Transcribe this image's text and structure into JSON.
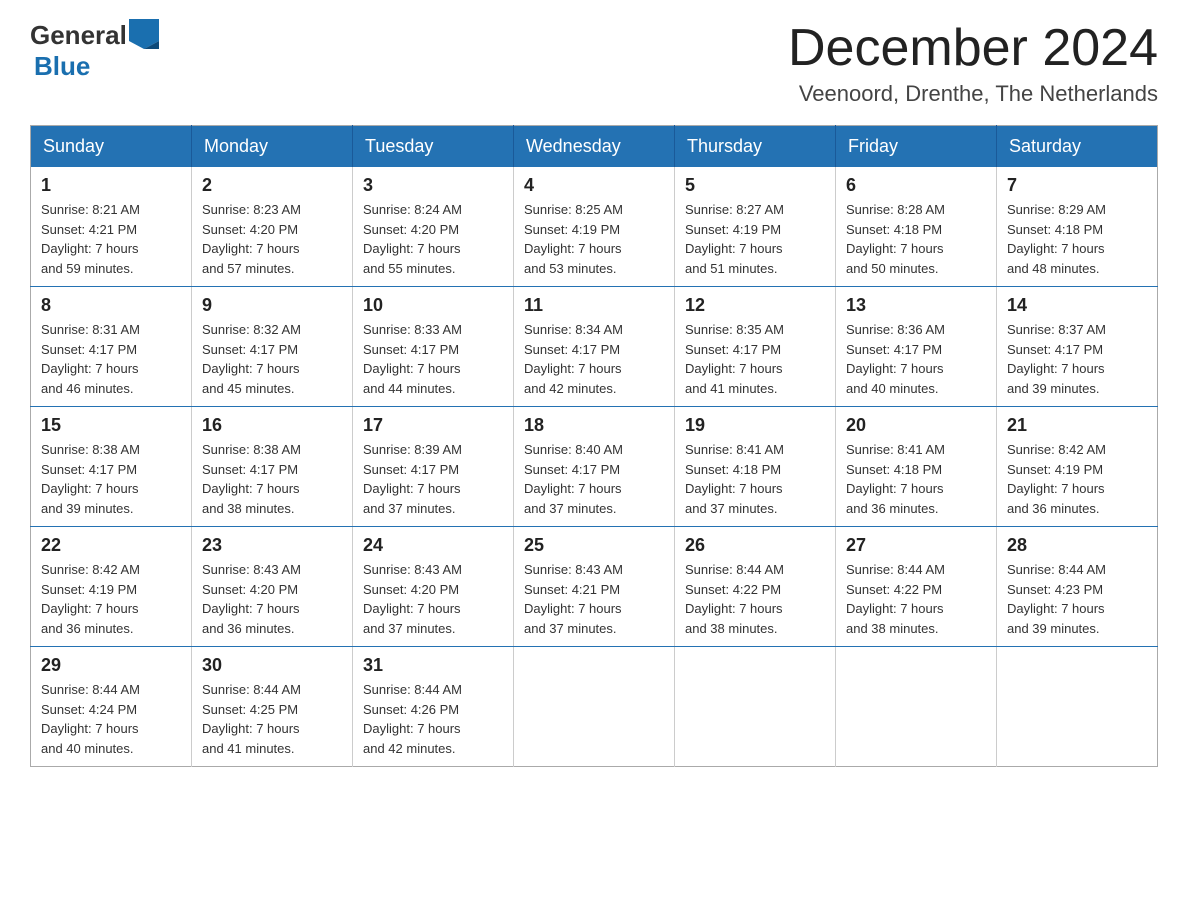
{
  "header": {
    "logo_general": "General",
    "logo_blue": "Blue",
    "month_title": "December 2024",
    "location": "Veenoord, Drenthe, The Netherlands"
  },
  "weekdays": [
    "Sunday",
    "Monday",
    "Tuesday",
    "Wednesday",
    "Thursday",
    "Friday",
    "Saturday"
  ],
  "weeks": [
    [
      {
        "day": "1",
        "sunrise": "8:21 AM",
        "sunset": "4:21 PM",
        "daylight": "7 hours and 59 minutes."
      },
      {
        "day": "2",
        "sunrise": "8:23 AM",
        "sunset": "4:20 PM",
        "daylight": "7 hours and 57 minutes."
      },
      {
        "day": "3",
        "sunrise": "8:24 AM",
        "sunset": "4:20 PM",
        "daylight": "7 hours and 55 minutes."
      },
      {
        "day": "4",
        "sunrise": "8:25 AM",
        "sunset": "4:19 PM",
        "daylight": "7 hours and 53 minutes."
      },
      {
        "day": "5",
        "sunrise": "8:27 AM",
        "sunset": "4:19 PM",
        "daylight": "7 hours and 51 minutes."
      },
      {
        "day": "6",
        "sunrise": "8:28 AM",
        "sunset": "4:18 PM",
        "daylight": "7 hours and 50 minutes."
      },
      {
        "day": "7",
        "sunrise": "8:29 AM",
        "sunset": "4:18 PM",
        "daylight": "7 hours and 48 minutes."
      }
    ],
    [
      {
        "day": "8",
        "sunrise": "8:31 AM",
        "sunset": "4:17 PM",
        "daylight": "7 hours and 46 minutes."
      },
      {
        "day": "9",
        "sunrise": "8:32 AM",
        "sunset": "4:17 PM",
        "daylight": "7 hours and 45 minutes."
      },
      {
        "day": "10",
        "sunrise": "8:33 AM",
        "sunset": "4:17 PM",
        "daylight": "7 hours and 44 minutes."
      },
      {
        "day": "11",
        "sunrise": "8:34 AM",
        "sunset": "4:17 PM",
        "daylight": "7 hours and 42 minutes."
      },
      {
        "day": "12",
        "sunrise": "8:35 AM",
        "sunset": "4:17 PM",
        "daylight": "7 hours and 41 minutes."
      },
      {
        "day": "13",
        "sunrise": "8:36 AM",
        "sunset": "4:17 PM",
        "daylight": "7 hours and 40 minutes."
      },
      {
        "day": "14",
        "sunrise": "8:37 AM",
        "sunset": "4:17 PM",
        "daylight": "7 hours and 39 minutes."
      }
    ],
    [
      {
        "day": "15",
        "sunrise": "8:38 AM",
        "sunset": "4:17 PM",
        "daylight": "7 hours and 39 minutes."
      },
      {
        "day": "16",
        "sunrise": "8:38 AM",
        "sunset": "4:17 PM",
        "daylight": "7 hours and 38 minutes."
      },
      {
        "day": "17",
        "sunrise": "8:39 AM",
        "sunset": "4:17 PM",
        "daylight": "7 hours and 37 minutes."
      },
      {
        "day": "18",
        "sunrise": "8:40 AM",
        "sunset": "4:17 PM",
        "daylight": "7 hours and 37 minutes."
      },
      {
        "day": "19",
        "sunrise": "8:41 AM",
        "sunset": "4:18 PM",
        "daylight": "7 hours and 37 minutes."
      },
      {
        "day": "20",
        "sunrise": "8:41 AM",
        "sunset": "4:18 PM",
        "daylight": "7 hours and 36 minutes."
      },
      {
        "day": "21",
        "sunrise": "8:42 AM",
        "sunset": "4:19 PM",
        "daylight": "7 hours and 36 minutes."
      }
    ],
    [
      {
        "day": "22",
        "sunrise": "8:42 AM",
        "sunset": "4:19 PM",
        "daylight": "7 hours and 36 minutes."
      },
      {
        "day": "23",
        "sunrise": "8:43 AM",
        "sunset": "4:20 PM",
        "daylight": "7 hours and 36 minutes."
      },
      {
        "day": "24",
        "sunrise": "8:43 AM",
        "sunset": "4:20 PM",
        "daylight": "7 hours and 37 minutes."
      },
      {
        "day": "25",
        "sunrise": "8:43 AM",
        "sunset": "4:21 PM",
        "daylight": "7 hours and 37 minutes."
      },
      {
        "day": "26",
        "sunrise": "8:44 AM",
        "sunset": "4:22 PM",
        "daylight": "7 hours and 38 minutes."
      },
      {
        "day": "27",
        "sunrise": "8:44 AM",
        "sunset": "4:22 PM",
        "daylight": "7 hours and 38 minutes."
      },
      {
        "day": "28",
        "sunrise": "8:44 AM",
        "sunset": "4:23 PM",
        "daylight": "7 hours and 39 minutes."
      }
    ],
    [
      {
        "day": "29",
        "sunrise": "8:44 AM",
        "sunset": "4:24 PM",
        "daylight": "7 hours and 40 minutes."
      },
      {
        "day": "30",
        "sunrise": "8:44 AM",
        "sunset": "4:25 PM",
        "daylight": "7 hours and 41 minutes."
      },
      {
        "day": "31",
        "sunrise": "8:44 AM",
        "sunset": "4:26 PM",
        "daylight": "7 hours and 42 minutes."
      },
      null,
      null,
      null,
      null
    ]
  ],
  "labels": {
    "sunrise": "Sunrise:",
    "sunset": "Sunset:",
    "daylight": "Daylight:"
  }
}
